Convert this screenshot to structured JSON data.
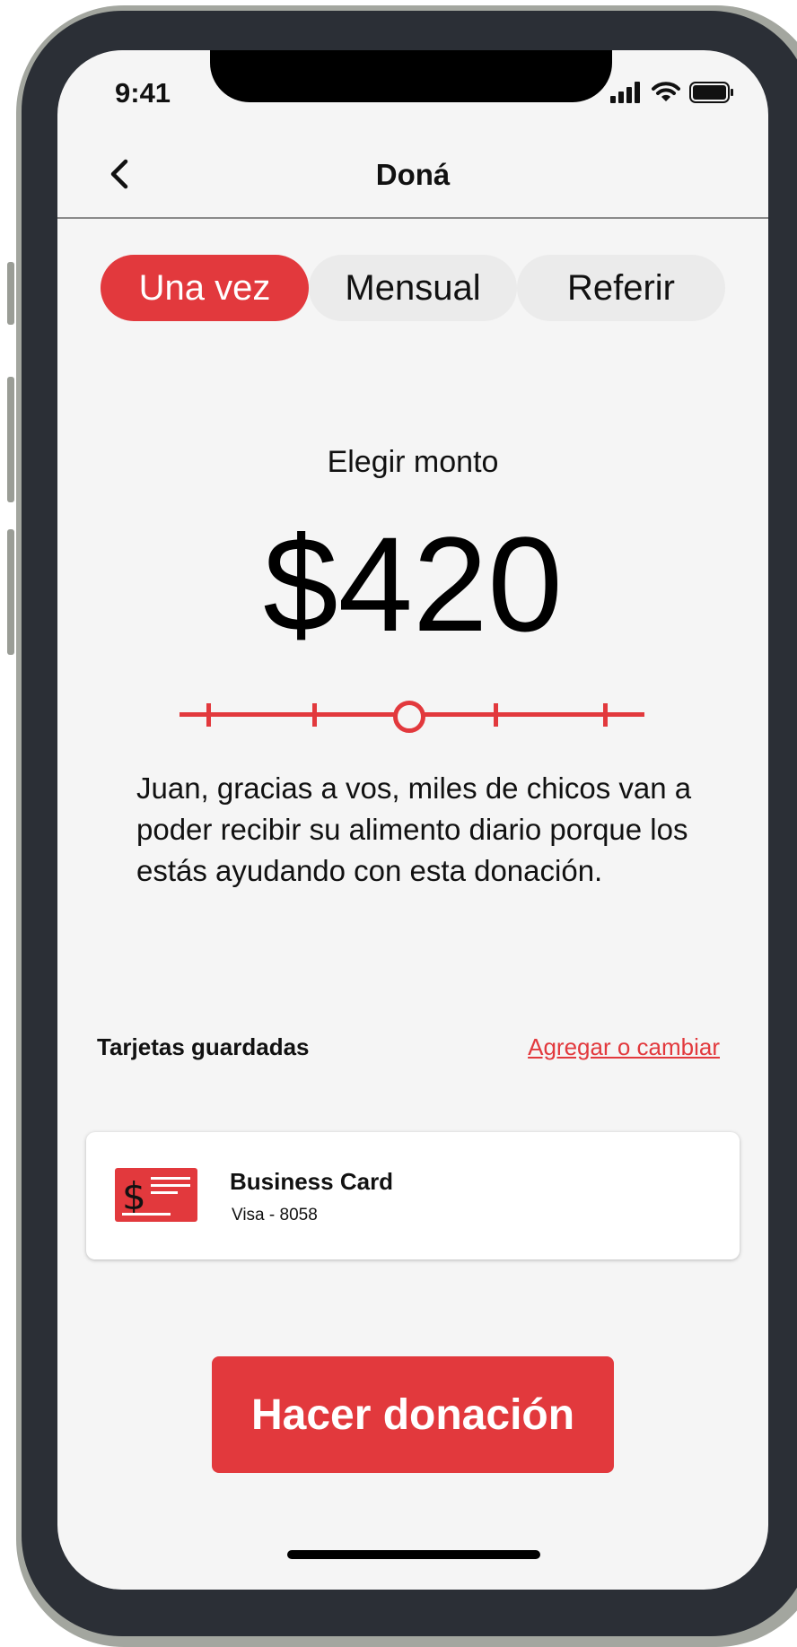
{
  "status_bar": {
    "time": "9:41"
  },
  "nav": {
    "title": "Doná"
  },
  "tabs": [
    {
      "label": "Una vez",
      "active": true
    },
    {
      "label": "Mensual",
      "active": false
    },
    {
      "label": "Referir",
      "active": false
    }
  ],
  "amount": {
    "label": "Elegir monto",
    "value": "$420",
    "slider_stops": 5,
    "slider_selected_fraction": 0.5
  },
  "message": "Juan, gracias a vos, miles de chicos van a poder recibir su alimento diario porque los estás ayudando con esta donación.",
  "saved_cards": {
    "heading": "Tarjetas guardadas",
    "link": "Agregar o cambiar",
    "cards": [
      {
        "name": "Business Card",
        "detail": "Visa - 8058",
        "icon": "credit-card-icon"
      }
    ]
  },
  "cta": {
    "label": "Hacer donación"
  },
  "colors": {
    "accent": "#e2393d",
    "background": "#f5f5f5",
    "frame": "#2b2f36"
  }
}
